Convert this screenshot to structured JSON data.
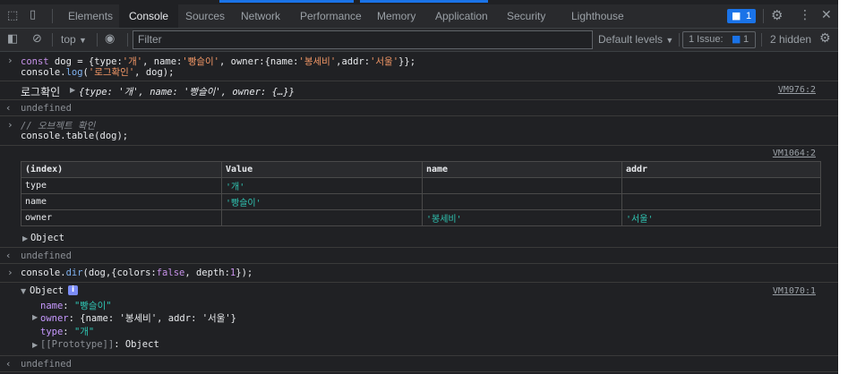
{
  "toolbar": {
    "tabs": [
      {
        "label": "Elements",
        "active": false
      },
      {
        "label": "Console",
        "active": true
      },
      {
        "label": "Sources",
        "active": false
      },
      {
        "label": "Network",
        "active": false
      },
      {
        "label": "Performance",
        "active": false
      },
      {
        "label": "Memory",
        "active": false
      },
      {
        "label": "Application",
        "active": false
      },
      {
        "label": "Security",
        "active": false
      },
      {
        "label": "Lighthouse",
        "active": false
      }
    ],
    "issues_count": "1",
    "icons": [
      "inspect-icon",
      "device-toggle-icon",
      "message-icon",
      "gear-icon",
      "more-icon",
      "close-icon"
    ]
  },
  "console_toolbar": {
    "context": "top",
    "filter_placeholder": "Filter",
    "levels": "Default levels",
    "issue_label": "1 Issue:",
    "issue_count": "1",
    "hidden": "2 hidden"
  },
  "entries": {
    "e1": {
      "code_parts": [
        "const",
        " dog = {",
        "type:",
        "'개'",
        ", name:",
        "'빵슬이'",
        ", owner:{name:",
        "'봉세비'",
        ",addr:",
        "'서울'",
        "}};"
      ],
      "line2_parts": [
        "console.",
        "log",
        "(",
        "'로그확인'",
        ", dog);"
      ]
    },
    "e2": {
      "label": "로그확인",
      "preview": "{type: '개', name: '빵슬이', owner: {…}}",
      "source": "VM976:2"
    },
    "e3": {
      "value": "undefined"
    },
    "e4": {
      "comment": "// 오브젝트 확인",
      "code": "console.table(dog);"
    },
    "e5": {
      "source": "VM1064:2",
      "headers": [
        "(index)",
        "Value",
        "name",
        "addr"
      ],
      "rows": [
        [
          "type",
          "'개'",
          "",
          ""
        ],
        [
          "name",
          "'빵슬이'",
          "",
          ""
        ],
        [
          "owner",
          "",
          "'봉세비'",
          "'서울'"
        ]
      ],
      "object_label": "Object"
    },
    "e6": {
      "value": "undefined"
    },
    "e7": {
      "code_parts": [
        "console.",
        "dir",
        "(dog,{colors:",
        "false",
        ", depth:",
        "1",
        "});"
      ]
    },
    "e8": {
      "source": "VM1070:1",
      "object_label": "Object",
      "props": {
        "name_key": "name",
        "name_val": "\"빵슬이\"",
        "owner_key": "owner",
        "owner_preview": "{name: '봉세비', addr: '서울'}",
        "type_key": "type",
        "type_val": "\"개\"",
        "proto_key": "[[Prototype]]",
        "proto_val": "Object"
      }
    },
    "e9": {
      "value": "undefined"
    }
  },
  "colors": {
    "background": "#202124",
    "toolbar": "#292a2d",
    "accent": "#1a73e8",
    "string": "#f29766",
    "keyword": "#c792ea",
    "table_string": "#2fc4b2"
  }
}
